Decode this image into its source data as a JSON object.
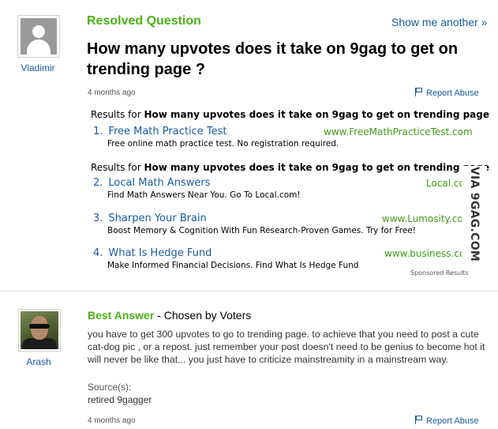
{
  "question": {
    "asker": "Vladimir",
    "status_label": "Resolved Question",
    "show_another_label": "Show me another »",
    "title": "How many upvotes does it take on 9gag to get on trending page ?",
    "time_ago": "4 months ago",
    "report_label": "Report Abuse"
  },
  "ads": {
    "results_prefix": "Results for",
    "query": "How many upvotes does it take on 9gag to get on trending page",
    "items": [
      {
        "num": "1.",
        "title": "Free Math Practice Test",
        "url": "www.FreeMathPracticeTest.com",
        "desc": "Free online math practice test. No registration required."
      },
      {
        "num": "2.",
        "title": "Local Math Answers",
        "url": "Local.com",
        "desc": "Find Math Answers Near You. Go To Local.com!"
      },
      {
        "num": "3.",
        "title": "Sharpen Your Brain",
        "url": "www.Lumosity.com",
        "desc": "Boost Memory & Cognition With Fun Research-Proven Games. Try for Free!"
      },
      {
        "num": "4.",
        "title": "What Is Hedge Fund",
        "url": "www.business.com",
        "desc": "Make Informed Financial Decisions. Find What Is Hedge Fund"
      }
    ],
    "sponsored_label": "Sponsored Results"
  },
  "answer": {
    "author": "Arash",
    "best_label": "Best Answer",
    "chosen_by": " - Chosen by Voters",
    "text": "you have to get 300 upvotes to go to trending page. to achieve that you need to post a cute cat-dog pic , or a repost. just remember your post doesn't need to be genius to become hot it will never be like that... you just have to criticize mainstreamity in a mainstream way.",
    "source_label": "Source(s):",
    "source_value": "retired 9gagger",
    "time_ago": "4 months ago",
    "report_label": "Report Abuse"
  },
  "watermark": "VIA 9GAG.COM",
  "colors": {
    "green": "#4bb117",
    "link": "#1a5a9c",
    "url_green": "#3f9a1a"
  },
  "icons": [
    "default-avatar-icon",
    "flag-icon"
  ]
}
